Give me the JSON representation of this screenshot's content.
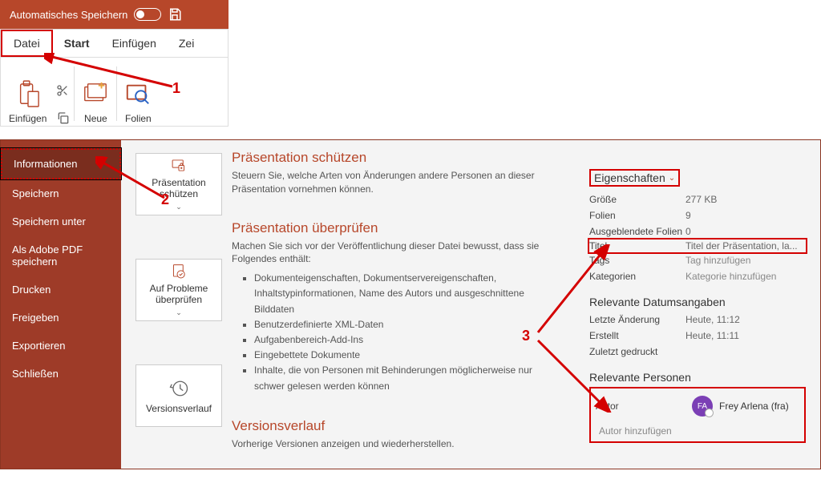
{
  "titlebar": {
    "autosave_label": "Automatisches Speichern"
  },
  "tabs": {
    "file": "Datei",
    "start": "Start",
    "insert": "Einfügen",
    "draw": "Zei"
  },
  "ribbon": {
    "paste": "Einfügen",
    "new": "Neue",
    "slides": "Folien"
  },
  "annotations": {
    "one": "1",
    "two": "2",
    "three": "3"
  },
  "sidebar": {
    "info": "Informationen",
    "save": "Speichern",
    "saveas": "Speichern unter",
    "pdf": "Als Adobe PDF speichern",
    "print": "Drucken",
    "share": "Freigeben",
    "export": "Exportieren",
    "close": "Schließen"
  },
  "buttons": {
    "protect": "Präsentation schützen",
    "check": "Auf Probleme überprüfen",
    "history": "Versionsverlauf"
  },
  "sections": {
    "protect": {
      "title": "Präsentation schützen",
      "desc": "Steuern Sie, welche Arten von Änderungen andere Personen an dieser Präsentation vornehmen können."
    },
    "check": {
      "title": "Präsentation überprüfen",
      "desc": "Machen Sie sich vor der Veröffentlichung dieser Datei bewusst, dass sie Folgendes enthält:",
      "items": [
        "Dokumenteigenschaften, Dokumentservereigenschaften, Inhaltstypinformationen, Name des Autors und ausgeschnittene Bilddaten",
        "Benutzerdefinierte XML-Daten",
        "Aufgabenbereich-Add-Ins",
        "Eingebettete Dokumente",
        "Inhalte, die von Personen mit Behinderungen möglicherweise nur schwer gelesen werden können"
      ]
    },
    "history": {
      "title": "Versionsverlauf",
      "desc": "Vorherige Versionen anzeigen und wiederherstellen."
    }
  },
  "properties": {
    "heading": "Eigenschaften",
    "rows": {
      "size": {
        "label": "Größe",
        "value": "277 KB"
      },
      "slides": {
        "label": "Folien",
        "value": "9"
      },
      "hidden": {
        "label": "Ausgeblendete Folien",
        "value": "0"
      },
      "title": {
        "label": "Titel",
        "value": "Titel der Präsentation, la..."
      },
      "tags": {
        "label": "Tags",
        "value": "Tag hinzufügen"
      },
      "categories": {
        "label": "Kategorien",
        "value": "Kategorie hinzufügen"
      }
    },
    "dates_heading": "Relevante Datumsangaben",
    "dates": {
      "modified": {
        "label": "Letzte Änderung",
        "value": "Heute, 11:12"
      },
      "created": {
        "label": "Erstellt",
        "value": "Heute, 11:11"
      },
      "printed": {
        "label": "Zuletzt gedruckt",
        "value": ""
      }
    },
    "people_heading": "Relevante Personen",
    "author_label": "Autor",
    "author_initials": "FA",
    "author_name": "Frey Arlena (fra)",
    "add_author": "Autor hinzufügen"
  }
}
